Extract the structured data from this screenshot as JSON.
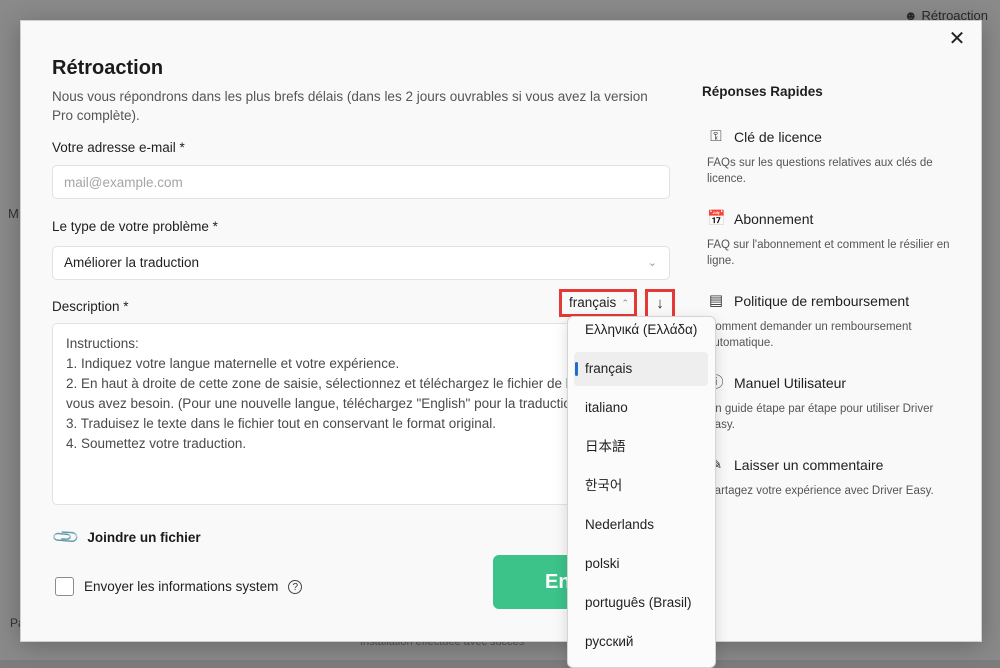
{
  "background": {
    "header_link": "Rétroaction",
    "side_m": "M",
    "side_p": "Pa",
    "bottom_text": "Installation effectuée avec succès"
  },
  "modal": {
    "title": "Rétroaction",
    "subtitle": "Nous vous répondrons dans les plus brefs délais (dans les 2 jours ouvrables si vous avez la version Pro complète).",
    "close_icon": "close-icon",
    "email": {
      "label": "Votre adresse e-mail *",
      "value": "",
      "placeholder": "mail@example.com"
    },
    "problem_type": {
      "label": "Le type de votre problème *",
      "selected": "Améliorer la traduction"
    },
    "description": {
      "label": "Description *",
      "language_selected": "français",
      "lines": [
        "Instructions:",
        "1. Indiquez votre langue maternelle et votre expérience.",
        "2. En haut à droite de cette zone de saisie, sélectionnez et téléchargez le fichier de langue dont",
        "vous avez besoin. (Pour une nouvelle langue, téléchargez \"English\" pour la traduction.)",
        "3. Traduisez le texte dans le fichier tout en conservant le format original.",
        "4. Soumettez votre traduction."
      ]
    },
    "attach_label": "Joindre un fichier",
    "system_info_label": "Envoyer les informations system",
    "send_label": "Envoyer"
  },
  "quick": {
    "title": "Réponses Rapides",
    "items": [
      {
        "icon": "key-icon",
        "title": "Clé de licence",
        "desc": "FAQs sur les questions relatives aux clés de licence."
      },
      {
        "icon": "calendar-check-icon",
        "title": "Abonnement",
        "desc": "FAQ sur l'abonnement et comment le résilier en ligne."
      },
      {
        "icon": "refund-icon",
        "title": "Politique de remboursement",
        "desc": "Comment demander un remboursement automatique."
      },
      {
        "icon": "manual-icon",
        "title": "Manuel Utilisateur",
        "desc": "Un guide étape par étape pour utiliser Driver Easy."
      },
      {
        "icon": "pencil-comment-icon",
        "title": "Laisser un commentaire",
        "desc": "Partagez votre expérience avec Driver Easy."
      }
    ]
  },
  "language_dropdown": {
    "options": [
      "Ελληνικά (Ελλάδα)",
      "français",
      "italiano",
      "日本語",
      "한국어",
      "Nederlands",
      "polski",
      "português (Brasil)",
      "русский"
    ],
    "selected_index": 1
  },
  "colors": {
    "accent_green": "#3cc38a",
    "highlight_red": "#e53935",
    "selected_indicator": "#1f6fc9"
  }
}
